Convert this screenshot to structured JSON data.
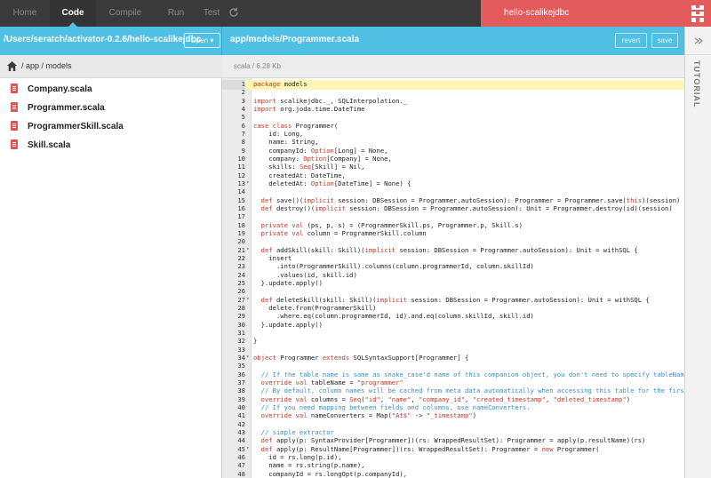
{
  "nav": {
    "items": [
      {
        "label": "Home"
      },
      {
        "label": "Code"
      },
      {
        "label": "Compile"
      },
      {
        "label": "Run"
      },
      {
        "label": "Test"
      }
    ],
    "app_name": "hello-scalikejdbc"
  },
  "project": {
    "path": "/Users/seratch/activator-0.2.6/hello-scalikejdbc",
    "open_label": "Open",
    "breadcrumb": "/ app / models"
  },
  "editor": {
    "file_path": "app/models/Programmer.scala",
    "file_meta": "scala / 6.28 Kb",
    "revert_label": "revert",
    "save_label": "save",
    "lines": [
      {
        "n": "1",
        "fold": "",
        "text": "package models"
      },
      {
        "n": "2",
        "fold": "",
        "text": ""
      },
      {
        "n": "3",
        "fold": "",
        "text": "import scalikejdbc._, SQLInterpolation._"
      },
      {
        "n": "4",
        "fold": "",
        "text": "import org.joda.time.DateTime"
      },
      {
        "n": "5",
        "fold": "",
        "text": ""
      },
      {
        "n": "6",
        "fold": "",
        "text": "case class Programmer("
      },
      {
        "n": "7",
        "fold": "",
        "text": "    id: Long,"
      },
      {
        "n": "8",
        "fold": "",
        "text": "    name: String,"
      },
      {
        "n": "9",
        "fold": "",
        "text": "    companyId: Option[Long] = None,"
      },
      {
        "n": "10",
        "fold": "",
        "text": "    company: Option[Company] = None,"
      },
      {
        "n": "11",
        "fold": "",
        "text": "    skills: Seq[Skill] = Nil,"
      },
      {
        "n": "12",
        "fold": "",
        "text": "    createdAt: DateTime,"
      },
      {
        "n": "13",
        "fold": "▾",
        "text": "    deletedAt: Option[DateTime] = None) {"
      },
      {
        "n": "14",
        "fold": "",
        "text": ""
      },
      {
        "n": "15",
        "fold": "",
        "text": "  def save()(implicit session: DBSession = Programmer.autoSession): Programmer = Programmer.save(this)(session)"
      },
      {
        "n": "16",
        "fold": "",
        "text": "  def destroy()(implicit session: DBSession = Programmer.autoSession): Unit = Programmer.destroy(id)(session)"
      },
      {
        "n": "17",
        "fold": "",
        "text": ""
      },
      {
        "n": "18",
        "fold": "",
        "text": "  private val (ps, p, s) = (ProgrammerSkill.ps, Programmer.p, Skill.s)"
      },
      {
        "n": "19",
        "fold": "",
        "text": "  private val column = ProgrammerSkill.column"
      },
      {
        "n": "20",
        "fold": "",
        "text": ""
      },
      {
        "n": "21",
        "fold": "▾",
        "text": "  def addSkill(skill: Skill)(implicit session: DBSession = Programmer.autoSession): Unit = withSQL {"
      },
      {
        "n": "22",
        "fold": "",
        "text": "    insert"
      },
      {
        "n": "23",
        "fold": "",
        "text": "      .into(ProgrammerSkill).columns(column.programmerId, column.skillId)"
      },
      {
        "n": "24",
        "fold": "",
        "text": "      .values(id, skill.id)"
      },
      {
        "n": "25",
        "fold": "",
        "text": "  }.update.apply()"
      },
      {
        "n": "26",
        "fold": "",
        "text": ""
      },
      {
        "n": "27",
        "fold": "▾",
        "text": "  def deleteSkill(skill: Skill)(implicit session: DBSession = Programmer.autoSession): Unit = withSQL {"
      },
      {
        "n": "28",
        "fold": "",
        "text": "    delete.from(ProgrammerSkill)"
      },
      {
        "n": "29",
        "fold": "",
        "text": "      .where.eq(column.programmerId, id).and.eq(column.skillId, skill.id)"
      },
      {
        "n": "30",
        "fold": "",
        "text": "  }.update.apply()"
      },
      {
        "n": "31",
        "fold": "",
        "text": ""
      },
      {
        "n": "32",
        "fold": "",
        "text": "}"
      },
      {
        "n": "33",
        "fold": "",
        "text": ""
      },
      {
        "n": "34",
        "fold": "▾",
        "text": "object Programmer extends SQLSyntaxSupport[Programmer] {"
      },
      {
        "n": "35",
        "fold": "",
        "text": ""
      },
      {
        "n": "36",
        "fold": "",
        "text": "  // If the table name is same as snake_case'd name of this companion object, you don't need to specify tableName expl"
      },
      {
        "n": "37",
        "fold": "",
        "text": "  override val tableName = \"programmer\""
      },
      {
        "n": "38",
        "fold": "",
        "text": "  // By default, column names will be cached from meta data automatically when accessing this table for the first time"
      },
      {
        "n": "39",
        "fold": "",
        "text": "  override val columns = Seq(\"id\", \"name\", \"company_id\", \"created_timestamp\", \"deleted_timestamp\")"
      },
      {
        "n": "40",
        "fold": "",
        "text": "  // If you need mapping between fields and columns, use nameConverters."
      },
      {
        "n": "41",
        "fold": "",
        "text": "  override val nameConverters = Map(\"At$\" -> \"_timestamp\")"
      },
      {
        "n": "42",
        "fold": "",
        "text": ""
      },
      {
        "n": "43",
        "fold": "",
        "text": "  // simple extractor"
      },
      {
        "n": "44",
        "fold": "",
        "text": "  def apply(p: SyntaxProvider[Programmer])(rs: WrappedResultSet): Programmer = apply(p.resultName)(rs)"
      },
      {
        "n": "45",
        "fold": "▾",
        "text": "  def apply(p: ResultName[Programmer])(rs: WrappedResultSet): Programmer = new Programmer("
      },
      {
        "n": "46",
        "fold": "",
        "text": "    id = rs.long(p.id),"
      },
      {
        "n": "47",
        "fold": "",
        "text": "    name = rs.string(p.name),"
      },
      {
        "n": "48",
        "fold": "",
        "text": "    companyId = rs.longOpt(p.companyId),"
      }
    ]
  },
  "sidebar": {
    "files": [
      {
        "name": "Company.scala"
      },
      {
        "name": "Programmer.scala"
      },
      {
        "name": "ProgrammerSkill.scala"
      },
      {
        "name": "Skill.scala"
      }
    ]
  },
  "rail": {
    "tutorial_label": "TUTORIAL"
  },
  "colors": {
    "accent": "#4fbfe3",
    "topbar": "#3a3a3a",
    "app_badge": "#e35b5b",
    "keyword": "#c0392b",
    "string": "#c0392b",
    "comment": "#3a8fc1",
    "active_line": "#fff5b5"
  }
}
